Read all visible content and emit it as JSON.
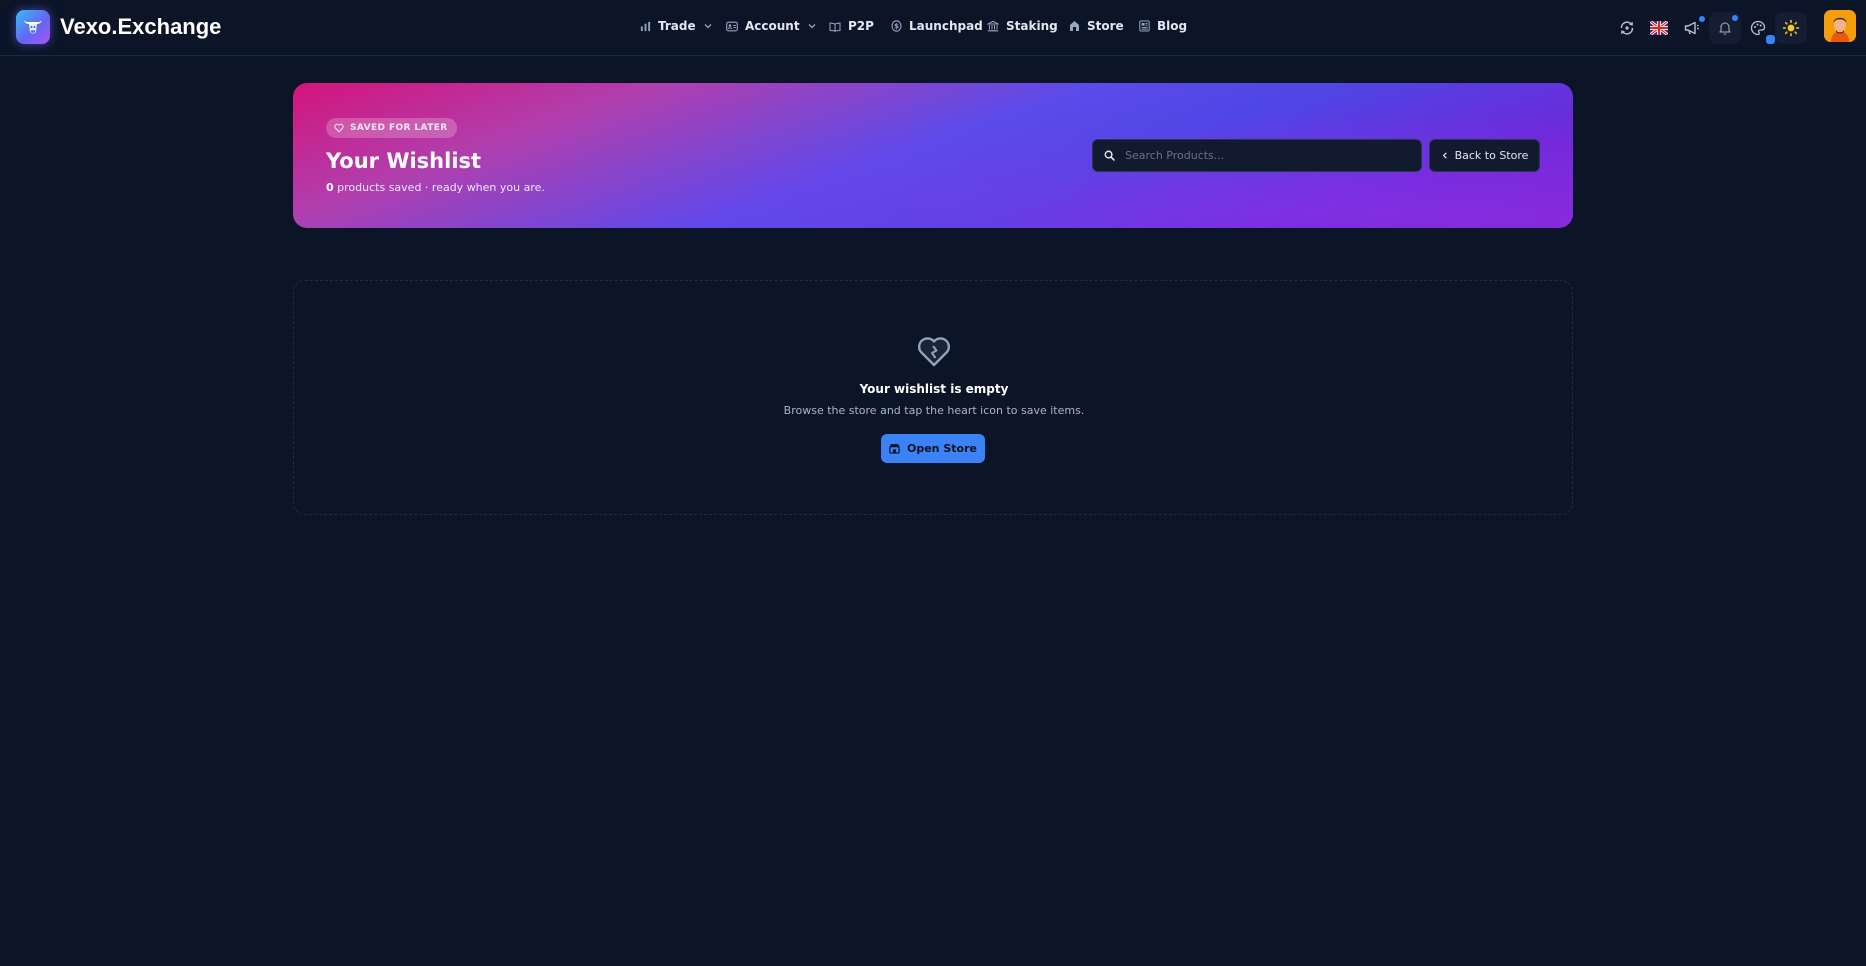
{
  "header": {
    "brand": "Vexo.Exchange",
    "nav": [
      {
        "label": "Trade",
        "icon": "bar-chart-icon",
        "dropdown": true
      },
      {
        "label": "Account",
        "icon": "id-card-icon",
        "dropdown": true
      },
      {
        "label": "P2P",
        "icon": "book-open-icon",
        "dropdown": false
      },
      {
        "label": "Launchpad",
        "icon": "dollar-coin-icon",
        "dropdown": false
      },
      {
        "label": "Staking",
        "icon": "bank-icon",
        "dropdown": false
      },
      {
        "label": "Store",
        "icon": "store-icon",
        "dropdown": false
      },
      {
        "label": "Blog",
        "icon": "newspaper-icon",
        "dropdown": false
      }
    ],
    "right_icons": [
      "transfer-icon",
      "uk-flag-icon",
      "megaphone-icon",
      "bell-icon",
      "palette-icon",
      "sun-icon",
      "avatar"
    ]
  },
  "hero": {
    "badge": "SAVED FOR LATER",
    "title": "Your Wishlist",
    "count": "0",
    "subtitle_rest": " products saved · ready when you are.",
    "search_placeholder": "Search Products...",
    "back_label": "Back to Store"
  },
  "empty": {
    "title": "Your wishlist is empty",
    "description": "Browse the store and tap the heart icon to save items.",
    "button_label": "Open Store"
  },
  "colors": {
    "background": "#0c1427",
    "accent": "#3b82f6",
    "hero_start": "#d4147b",
    "hero_mid": "#4f46e5",
    "hero_end": "#7e22ce"
  }
}
